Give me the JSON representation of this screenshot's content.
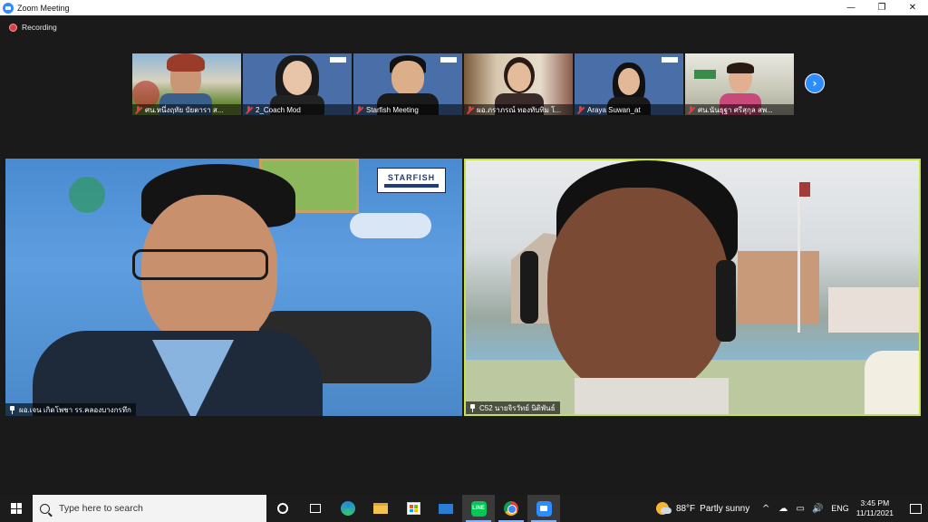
{
  "window": {
    "title": "Zoom Meeting",
    "controls": [
      "—",
      "❐",
      "✕"
    ]
  },
  "recording": {
    "label": "Recording"
  },
  "gallery": [
    {
      "name": "ศน.หนึ่งฤทัย  บัยตารา  ส...",
      "muted": true
    },
    {
      "name": "2_Coach Mod",
      "muted": true
    },
    {
      "name": "Starfish Meeting",
      "muted": true
    },
    {
      "name": "ผอ.ภราภรณ์ ทองทับทิม โ...",
      "muted": true
    },
    {
      "name": "Araya Suwan_at",
      "muted": true
    },
    {
      "name": "ศน.นันธุฐา  ศรีสุกุล  สพ...",
      "muted": true
    }
  ],
  "next_page_glyph": "›",
  "main_videos": {
    "left": {
      "name": "ผอ.เจน เกิดโพชา รร.คลองบางกรทึก",
      "logo": "STARFISH"
    },
    "right": {
      "name": "C52 นายจิรวัทย์ นิติพันธ์",
      "active_speaker": true
    }
  },
  "taskbar": {
    "search_placeholder": "Type here to search",
    "line_label": "LINE",
    "weather": {
      "temp": "88°F",
      "condition": "Partly sunny"
    },
    "tray_icons": [
      "^",
      "☁",
      "▭",
      "🔊"
    ],
    "language": "ENG",
    "time": "3:45 PM",
    "date": "11/11/2021"
  },
  "colors": {
    "active_speaker_border": "#c7e34a",
    "zoom_blue": "#2d8cff",
    "muted_red": "#e03e3e"
  }
}
